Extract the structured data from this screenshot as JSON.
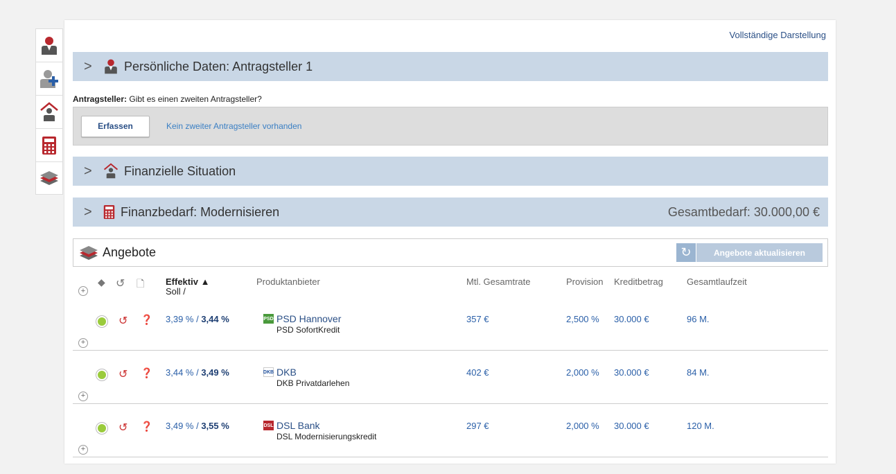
{
  "nav": {
    "items": [
      {
        "name": "person",
        "icon": "person-icon"
      },
      {
        "name": "add-person",
        "icon": "add-person-icon"
      },
      {
        "name": "house-person",
        "icon": "house-person-icon"
      },
      {
        "name": "calculator",
        "icon": "calculator-icon"
      },
      {
        "name": "offers",
        "icon": "stack-icon"
      }
    ]
  },
  "header": {
    "full_view_link": "Vollständige Darstellung"
  },
  "sections": {
    "personal": {
      "title": "Persönliche Daten: Antragsteller 1"
    },
    "financial": {
      "title": "Finanzielle Situation"
    },
    "demand": {
      "title": "Finanzbedarf: Modernisieren",
      "total": "Gesamtbedarf: 30.000,00 €"
    }
  },
  "applicant": {
    "question_label": "Antragsteller:",
    "question_text": " Gibt es einen zweiten Antragsteller?",
    "capture_button": "Erfassen",
    "no_second": "Kein zweiter Antragsteller vorhanden"
  },
  "offers": {
    "title": "Angebote",
    "refresh_label": "Angebote aktualisieren",
    "columns": {
      "rate_soll": "Soll / ",
      "rate_eff": "Effektiv ▲",
      "provider": "Produktanbieter",
      "monthly": "Mtl. Gesamtrate",
      "commission": "Provision",
      "credit": "Kreditbetrag",
      "term": "Gesamtlaufzeit"
    },
    "rows": [
      {
        "soll": "3,39 % / ",
        "eff": "3,44 %",
        "provider": "PSD Hannover",
        "product": "PSD SofortKredit",
        "logo": "PSD",
        "monthly": "357 €",
        "commission": "2,500 %",
        "credit": "30.000 €",
        "term": "96 M."
      },
      {
        "soll": "3,44 % / ",
        "eff": "3,49 %",
        "provider": "DKB",
        "product": "DKB Privatdarlehen",
        "logo": "DKB",
        "monthly": "402 €",
        "commission": "2,000 %",
        "credit": "30.000 €",
        "term": "84 M."
      },
      {
        "soll": "3,49 % / ",
        "eff": "3,55 %",
        "provider": "DSL Bank",
        "product": "DSL Modernisierungskredit",
        "logo": "DSL",
        "monthly": "297 €",
        "commission": "2,000 %",
        "credit": "30.000 €",
        "term": "120 M."
      }
    ]
  },
  "colors": {
    "section_bar": "#c9d7e6",
    "accent": "#2a4f86",
    "status_green": "#9acb3c",
    "icon_red": "#b8282e"
  }
}
